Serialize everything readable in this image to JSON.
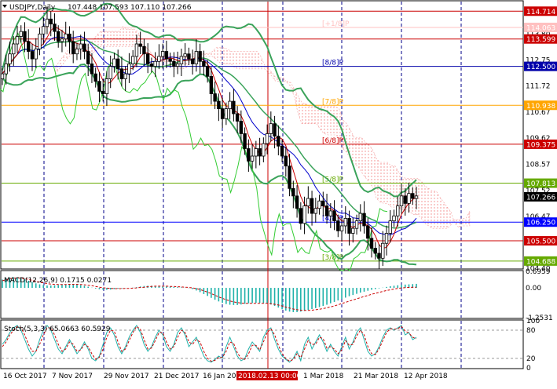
{
  "header": {
    "symbol": "USDJPY,Daily",
    "ohlc": "107.448 107.593 107.110 107.266"
  },
  "chart_data": [
    {
      "type": "line",
      "title": "USDJPY,Daily",
      "ohlc_last": {
        "open": 107.448,
        "high": 107.593,
        "low": 107.11,
        "close": 107.266
      },
      "ylim": [
        104.4,
        115.1
      ],
      "y_ticks": [
        114.71,
        113.8,
        112.75,
        111.72,
        110.67,
        109.62,
        108.57,
        107.52,
        106.47,
        105.45,
        104.4
      ],
      "x_tick_labels": [
        "16 Oct 2017",
        "7 Nov 2017",
        "29 Nov 2017",
        "21 Dec 2017",
        "16 Jan 20",
        "2018.02.13 00:00",
        "1 Mar 2018",
        "21 Mar 2018",
        "12 Apr 2018"
      ],
      "murrey_levels": [
        {
          "label": "[+1/8]P",
          "value": 114.063,
          "color": "#ffc0c0"
        },
        {
          "label": "[8/8]P",
          "value": 112.5,
          "color": "#0000aa"
        },
        {
          "label": "[7/8]P",
          "value": 110.938,
          "color": "#ffa500"
        },
        {
          "label": "[6/8]P",
          "value": 109.375,
          "color": "#cc0000"
        },
        {
          "label": "[5/8]P",
          "value": 107.813,
          "color": "#66aa00"
        },
        {
          "label": "[4/8]P",
          "value": 106.25,
          "color": "#0000ff"
        },
        {
          "label": "",
          "value": 105.5,
          "color": "#cc0000"
        },
        {
          "label": "[3/8]P",
          "value": 104.688,
          "color": "#66aa00"
        }
      ],
      "price_labels": [
        {
          "text": "114.714",
          "value": 114.714,
          "color": "#cc0000"
        },
        {
          "text": "114.063",
          "value": 114.063,
          "color": "#ffc0c0"
        },
        {
          "text": "113.599",
          "value": 113.599,
          "color": "#cc0000"
        },
        {
          "text": "112.500",
          "value": 112.5,
          "color": "#0000aa"
        },
        {
          "text": "110.938",
          "value": 110.938,
          "color": "#ffa500"
        },
        {
          "text": "109.375",
          "value": 109.375,
          "color": "#cc0000"
        },
        {
          "text": "107.813",
          "value": 107.813,
          "color": "#66aa00"
        },
        {
          "text": "107.266",
          "value": 107.266,
          "color": "#000000"
        },
        {
          "text": "106.250",
          "value": 106.25,
          "color": "#0000ff"
        },
        {
          "text": "105.500",
          "value": 105.5,
          "color": "#cc0000"
        },
        {
          "text": "104.688",
          "value": 104.688,
          "color": "#66aa00"
        }
      ],
      "close_series": [
        112.2,
        112.6,
        113.0,
        113.4,
        113.7,
        113.9,
        113.5,
        113.1,
        112.8,
        113.2,
        113.8,
        114.1,
        114.4,
        114.2,
        113.9,
        113.5,
        113.6,
        113.8,
        113.5,
        113.0,
        113.2,
        113.4,
        113.1,
        112.6,
        112.2,
        111.9,
        111.5,
        111.4,
        112.0,
        112.5,
        112.8,
        112.4,
        112.0,
        112.2,
        112.6,
        112.9,
        113.4,
        113.3,
        113.0,
        112.6,
        112.5,
        112.7,
        112.9,
        113.1,
        112.8,
        112.7,
        112.5,
        112.6,
        112.9,
        113.0,
        112.8,
        112.6,
        113.1,
        112.7,
        112.5,
        112.1,
        111.4,
        111.1,
        110.8,
        110.4,
        110.8,
        111.1,
        110.6,
        110.3,
        109.8,
        109.2,
        108.7,
        108.9,
        109.2,
        108.9,
        109.4,
        109.8,
        110.2,
        109.7,
        109.3,
        108.9,
        108.5,
        107.6,
        107.3,
        106.8,
        106.2,
        106.9,
        107.2,
        106.6,
        106.8,
        107.1,
        106.9,
        106.5,
        106.7,
        106.3,
        105.9,
        106.1,
        106.4,
        105.8,
        106.0,
        106.3,
        106.6,
        106.1,
        105.6,
        105.2,
        105.0,
        104.8,
        105.4,
        105.8,
        106.3,
        106.5,
        106.9,
        107.3,
        107.0,
        107.4,
        107.2,
        107.3
      ],
      "indicators": {
        "bollinger_bands": true,
        "ichimoku_cloud": true,
        "moving_averages": true
      }
    },
    {
      "type": "bar",
      "title": "MACD(12,26,9) 0.1715 0.0271",
      "ylim": [
        -1.2531,
        0.6959
      ],
      "y_ticks": [
        "0.6959",
        "0.00",
        "-1.2531"
      ],
      "histogram": [
        0.35,
        0.41,
        0.44,
        0.45,
        0.44,
        0.41,
        0.36,
        0.3,
        0.24,
        0.19,
        0.15,
        0.12,
        0.1,
        0.1,
        0.11,
        0.12,
        0.14,
        0.15,
        0.16,
        0.16,
        0.14,
        0.12,
        0.09,
        0.05,
        0.01,
        -0.03,
        -0.06,
        -0.08,
        -0.08,
        -0.07,
        -0.05,
        -0.03,
        -0.02,
        -0.01,
        0.0,
        0.01,
        0.03,
        0.06,
        0.08,
        0.09,
        0.09,
        0.08,
        0.07,
        0.06,
        0.06,
        0.05,
        0.04,
        0.03,
        0.02,
        0.01,
        -0.01,
        -0.05,
        -0.11,
        -0.18,
        -0.26,
        -0.34,
        -0.42,
        -0.5,
        -0.57,
        -0.63,
        -0.68,
        -0.71,
        -0.72,
        -0.72,
        -0.7,
        -0.67,
        -0.65,
        -0.64,
        -0.63,
        -0.63,
        -0.64,
        -0.66,
        -0.7,
        -0.76,
        -0.83,
        -0.9,
        -0.96,
        -1.0,
        -1.02,
        -1.02,
        -1.0,
        -0.97,
        -0.93,
        -0.89,
        -0.85,
        -0.81,
        -0.76,
        -0.71,
        -0.65,
        -0.59,
        -0.53,
        -0.47,
        -0.41,
        -0.35,
        -0.3,
        -0.25,
        -0.2,
        -0.16,
        -0.12,
        -0.08,
        -0.05,
        -0.02,
        0.01,
        0.04,
        0.07,
        0.09,
        0.11,
        0.13,
        0.14,
        0.15,
        0.16,
        0.17
      ],
      "signal": [
        0.3,
        0.35,
        0.39,
        0.41,
        0.42,
        0.41,
        0.39,
        0.36,
        0.32,
        0.28,
        0.24,
        0.21,
        0.18,
        0.16,
        0.15,
        0.14,
        0.14,
        0.14,
        0.15,
        0.15,
        0.15,
        0.14,
        0.13,
        0.11,
        0.09,
        0.06,
        0.03,
        0.01,
        -0.01,
        -0.02,
        -0.03,
        -0.03,
        -0.03,
        -0.02,
        -0.02,
        -0.01,
        0.0,
        0.02,
        0.03,
        0.05,
        0.06,
        0.07,
        0.07,
        0.07,
        0.07,
        0.06,
        0.06,
        0.05,
        0.04,
        0.03,
        0.02,
        0.0,
        -0.03,
        -0.07,
        -0.12,
        -0.18,
        -0.24,
        -0.31,
        -0.38,
        -0.44,
        -0.5,
        -0.55,
        -0.59,
        -0.62,
        -0.64,
        -0.65,
        -0.65,
        -0.65,
        -0.65,
        -0.65,
        -0.65,
        -0.65,
        -0.67,
        -0.69,
        -0.72,
        -0.76,
        -0.81,
        -0.85,
        -0.89,
        -0.92,
        -0.94,
        -0.95,
        -0.95,
        -0.94,
        -0.92,
        -0.9,
        -0.87,
        -0.84,
        -0.8,
        -0.76,
        -0.71,
        -0.66,
        -0.61,
        -0.56,
        -0.51,
        -0.46,
        -0.41,
        -0.36,
        -0.32,
        -0.27,
        -0.23,
        -0.19,
        -0.15,
        -0.11,
        -0.08,
        -0.05,
        -0.02,
        0.0,
        0.01,
        0.02,
        0.03,
        0.03
      ]
    },
    {
      "type": "line",
      "title": "Stoch(5,3,3) 65.0663 60.5929",
      "ylim": [
        0,
        100
      ],
      "y_ticks": [
        "100",
        "80",
        "20",
        "0"
      ],
      "series": [
        {
          "values": [
            50,
            60,
            75,
            85,
            90,
            80,
            60,
            40,
            25,
            35,
            60,
            80,
            90,
            80,
            60,
            40,
            30,
            45,
            60,
            45,
            30,
            40,
            55,
            40,
            20,
            15,
            25,
            50,
            75,
            85,
            70,
            45,
            30,
            45,
            65,
            80,
            90,
            75,
            50,
            35,
            45,
            65,
            80,
            70,
            45,
            35,
            50,
            75,
            85,
            70,
            45,
            55,
            65,
            45,
            25,
            15,
            12,
            18,
            25,
            20,
            45,
            65,
            45,
            25,
            15,
            20,
            40,
            55,
            45,
            35,
            65,
            80,
            85,
            60,
            40,
            25,
            18,
            12,
            20,
            35,
            15,
            50,
            65,
            40,
            55,
            70,
            55,
            35,
            50,
            35,
            25,
            45,
            65,
            40,
            55,
            75,
            85,
            60,
            35,
            25,
            30,
            45,
            65,
            80,
            85,
            80,
            85,
            90,
            70,
            75,
            60,
            65
          ]
        },
        {
          "values": [
            45,
            55,
            70,
            80,
            88,
            85,
            70,
            50,
            35,
            35,
            50,
            70,
            85,
            85,
            70,
            50,
            35,
            40,
            55,
            50,
            35,
            38,
            50,
            45,
            30,
            18,
            22,
            40,
            65,
            80,
            78,
            55,
            35,
            40,
            58,
            75,
            88,
            82,
            60,
            40,
            42,
            58,
            75,
            75,
            55,
            40,
            45,
            65,
            80,
            75,
            55,
            50,
            60,
            55,
            35,
            20,
            14,
            16,
            22,
            22,
            35,
            55,
            52,
            32,
            20,
            18,
            30,
            48,
            48,
            38,
            55,
            75,
            83,
            70,
            48,
            30,
            20,
            14,
            18,
            30,
            22,
            40,
            58,
            50,
            50,
            65,
            62,
            42,
            45,
            40,
            30,
            38,
            58,
            48,
            50,
            68,
            80,
            70,
            45,
            30,
            28,
            40,
            58,
            75,
            83,
            82,
            83,
            88,
            78,
            74,
            65,
            62
          ]
        }
      ]
    }
  ]
}
